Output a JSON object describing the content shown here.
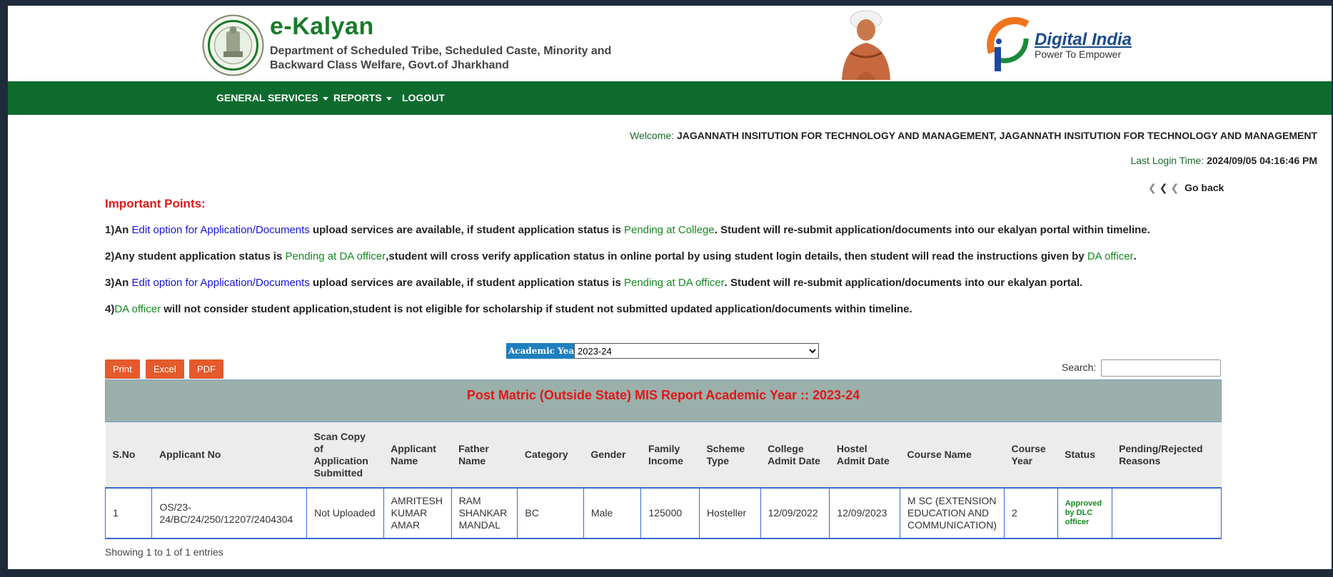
{
  "header": {
    "brand_title": "e-Kalyan",
    "brand_subtitle": "Department of Scheduled Tribe, Scheduled Caste, Minority and Backward Class Welfare, Govt.of Jharkhand",
    "digital_india_title": "Digital India",
    "digital_india_tagline": "Power To Empower"
  },
  "nav": {
    "items": [
      {
        "label": "GENERAL SERVICES",
        "dropdown": true
      },
      {
        "label": "REPORTS",
        "dropdown": true
      },
      {
        "label": "LOGOUT",
        "dropdown": false
      }
    ]
  },
  "user": {
    "welcome_label": "Welcome:",
    "welcome_value": "JAGANNATH INSITUTION FOR TECHNOLOGY AND MANAGEMENT, JAGANNATH INSITUTION FOR TECHNOLOGY AND MANAGEMENT",
    "last_login_label": "Last Login Time:",
    "last_login_value": "2024/09/05 04:16:46 PM",
    "go_back": "Go back"
  },
  "important": {
    "title": "Important Points:",
    "points": [
      {
        "p1": "1)An ",
        "p2": "Edit option for Application/Documents",
        "p3": " upload services are available, if student application status is ",
        "p4": "Pending at College",
        "p5": ". Student will re-submit application/documents into our ekalyan portal within timeline."
      },
      {
        "p1": "2)Any student application status is ",
        "p2": "Pending at DA officer",
        "p3": ",student will cross verify application status in online portal by using student login details, then student will read the instructions given by ",
        "p4": "DA officer",
        "p5": "."
      },
      {
        "p1": "3)An ",
        "p2": "Edit option for Application/Documents",
        "p3": " upload services are available, if student application status is ",
        "p4": "Pending at DA officer",
        "p5": ". Student will re-submit application/documents into our ekalyan portal."
      },
      {
        "p1": "4)",
        "p2": "DA officer",
        "p3": " will not consider student application,student is not eligible for scholarship if student not submitted updated application/documents within timeline."
      }
    ]
  },
  "filter": {
    "academic_year_label": "Academic Year:",
    "academic_year_value": "2023-24"
  },
  "toolbar": {
    "print": "Print",
    "excel": "Excel",
    "pdf": "PDF",
    "search_label": "Search:",
    "search_value": ""
  },
  "report": {
    "title": "Post Matric (Outside State) MIS Report Academic Year :: 2023-24",
    "columns": {
      "sno": "S.No",
      "applicant_no": "Applicant No",
      "scan_copy": "Scan Copy of Application Submitted",
      "applicant_name": "Applicant Name",
      "father_name": "Father Name",
      "category": "Category",
      "gender": "Gender",
      "family_income": "Family Income",
      "scheme_type": "Scheme Type",
      "college_admit_date": "College Admit Date",
      "hostel_admit_date": "Hostel Admit Date",
      "course_name": "Course Name",
      "course_year": "Course Year",
      "status": "Status",
      "pending_reasons": "Pending/Rejected Reasons"
    },
    "rows": [
      {
        "sno": "1",
        "applicant_no": "OS/23-24/BC/24/250/12207/2404304",
        "scan_copy": "Not Uploaded",
        "applicant_name": "AMRITESH KUMAR AMAR",
        "father_name": "RAM SHANKAR MANDAL",
        "category": "BC",
        "gender": "Male",
        "family_income": "125000",
        "scheme_type": "Hosteller",
        "college_admit_date": "12/09/2022",
        "hostel_admit_date": "12/09/2023",
        "course_name": "M SC (EXTENSION EDUCATION AND COMMUNICATION)",
        "course_year": "2",
        "status": "Approved by DLC officer",
        "pending_reasons": ""
      }
    ],
    "showing": "Showing 1 to 1 of 1 entries"
  },
  "colors": {
    "nav_green": "#0e6b2e",
    "brand_green": "#1a7a2a",
    "alert_red": "#e01818",
    "button_orange": "#e45a2c",
    "link_blue": "#1515d6"
  }
}
